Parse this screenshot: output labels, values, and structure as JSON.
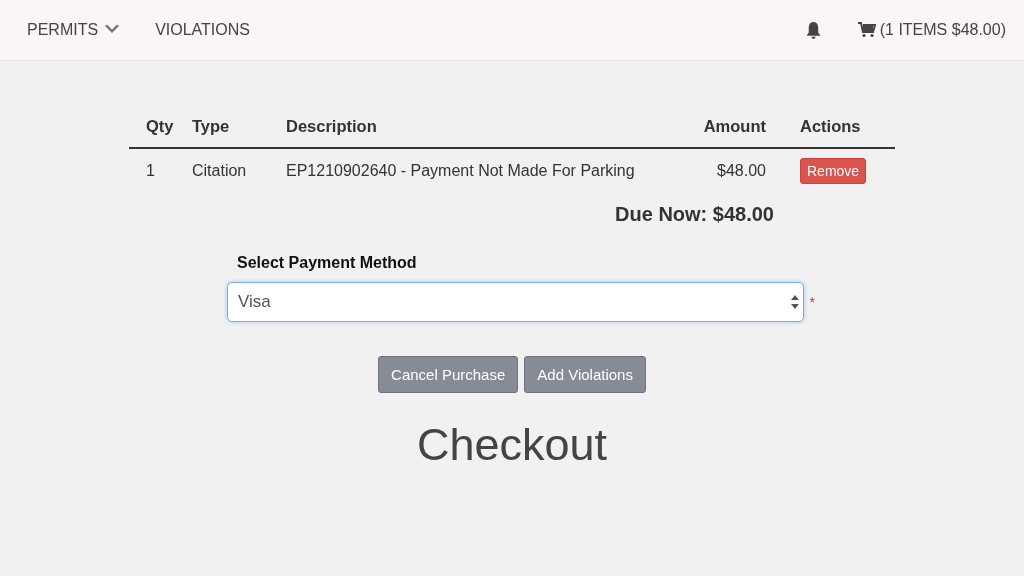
{
  "navbar": {
    "menu": [
      {
        "label": "PERMITS",
        "kind": "dropdown"
      },
      {
        "label": "VIOLATIONS",
        "kind": "link"
      }
    ],
    "cart": "(1 ITEMS $48.00)"
  },
  "table": {
    "columns": [
      "Qty",
      "Type",
      "Description",
      "Amount",
      "Actions"
    ],
    "rows": [
      {
        "qty": "1",
        "type": "Citation",
        "description": "EP1210902640 - Payment Not Made For Parking",
        "amount": "$48.00",
        "action": "Remove"
      }
    ]
  },
  "due_now": "Due Now: $48.00",
  "payment": {
    "label": "Select Payment Method",
    "value": "Visa",
    "required_mark": "*"
  },
  "buttons": [
    "Cancel Purchase",
    "Add Violations"
  ],
  "heading": "Checkout"
}
